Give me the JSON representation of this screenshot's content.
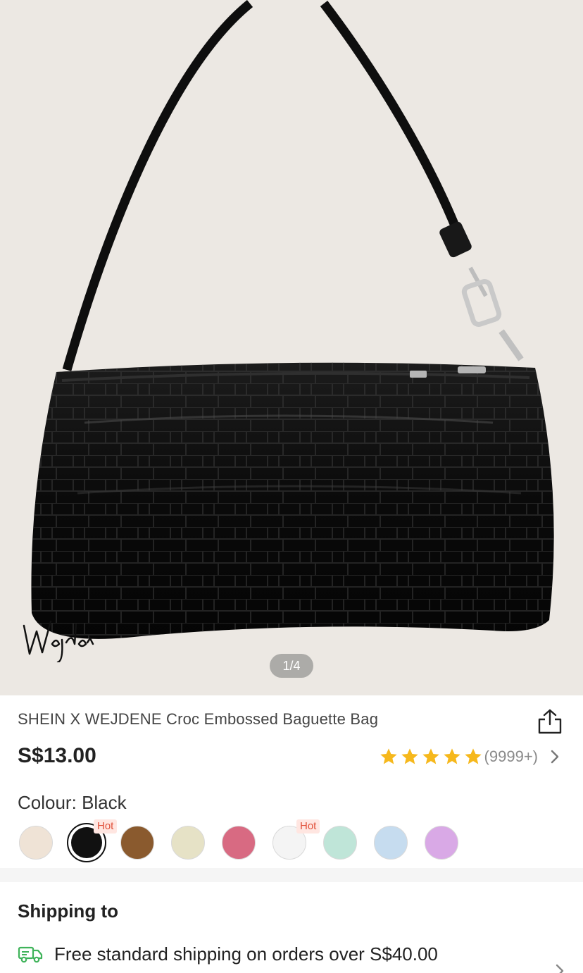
{
  "gallery": {
    "page_indicator": "1/4",
    "watermark_signature": "Wejdene"
  },
  "product": {
    "title": "SHEIN X WEJDENE Croc Embossed Baguette Bag",
    "price": "S$13.00",
    "rating": {
      "stars": 5,
      "count_label": "(9999+)"
    },
    "colour_label": "Colour:",
    "colour_value": "Black",
    "swatches": [
      {
        "color": "#efe3d6",
        "selected": false,
        "hot": false
      },
      {
        "color": "#111111",
        "selected": true,
        "hot": true,
        "badge": "Hot"
      },
      {
        "color": "#8a5a2e",
        "selected": false,
        "hot": false
      },
      {
        "color": "#e6e2c6",
        "selected": false,
        "hot": false
      },
      {
        "color": "#d86a82",
        "selected": false,
        "hot": false
      },
      {
        "color": "#f4f4f4",
        "selected": false,
        "hot": true,
        "badge": "Hot"
      },
      {
        "color": "#bfe5d8",
        "selected": false,
        "hot": false
      },
      {
        "color": "#c6dcef",
        "selected": false,
        "hot": false
      },
      {
        "color": "#d9a9e6",
        "selected": false,
        "hot": false
      }
    ]
  },
  "shipping": {
    "title": "Shipping to",
    "free_shipping_text": "Free standard shipping on orders over S$40.00"
  },
  "colors": {
    "accent_star": "#f6b81c",
    "hot_badge_text": "#e0503a",
    "shipping_icon": "#3fb35a"
  }
}
